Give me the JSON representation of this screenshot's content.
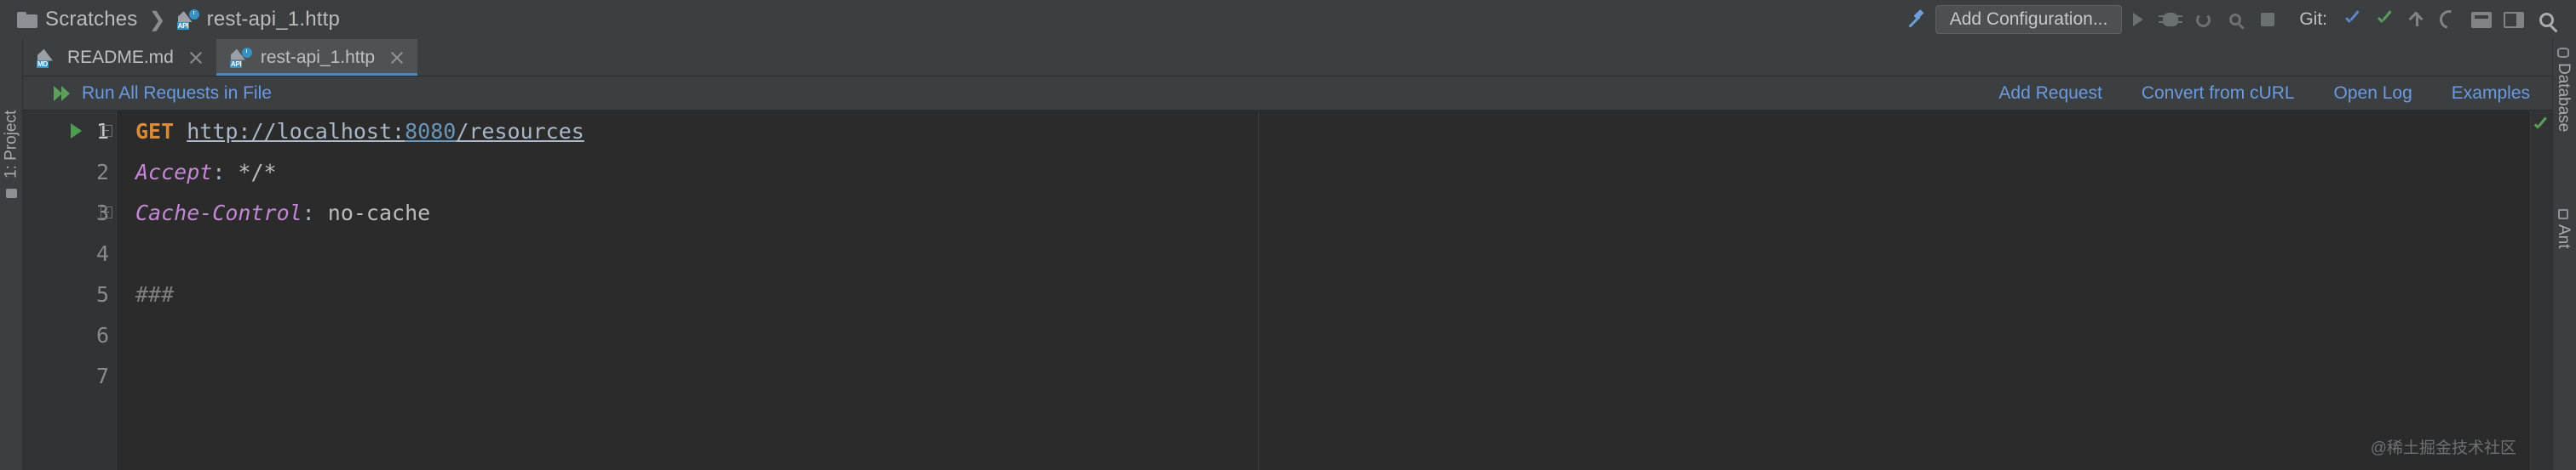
{
  "window": {
    "breadcrumb": [
      {
        "icon": "folder-icon",
        "label": "Scratches"
      },
      {
        "icon": "http-file-icon",
        "label": "rest-api_1.http"
      }
    ],
    "separator": "❯"
  },
  "toolbar": {
    "build_icon": "hammer-icon",
    "run_configuration": "Add Configuration...",
    "actions": [
      {
        "name": "run-button",
        "icon": "run-triangle-icon"
      },
      {
        "name": "debug-button",
        "icon": "bug-icon"
      },
      {
        "name": "rerun-button",
        "icon": "rerun-icon"
      },
      {
        "name": "profile-button",
        "icon": "magnifier-icon"
      },
      {
        "name": "stop-button",
        "icon": "stop-square-icon"
      }
    ],
    "git_label": "Git:",
    "git_actions": [
      {
        "name": "git-update-button",
        "icon": "check-blue-icon"
      },
      {
        "name": "git-commit-button",
        "icon": "check-green-icon"
      },
      {
        "name": "git-push-button",
        "icon": "arrow-up-icon"
      },
      {
        "name": "git-rollback-button",
        "icon": "undo-icon"
      }
    ],
    "right_actions": [
      {
        "name": "tray-button",
        "icon": "tray-icon"
      },
      {
        "name": "layout-button",
        "icon": "layout-icon"
      },
      {
        "name": "search-everywhere-button",
        "icon": "search-icon"
      }
    ]
  },
  "left_strip": {
    "project_label": "1: Project"
  },
  "right_strip": {
    "database_label": "Database",
    "ant_label": "Ant"
  },
  "tabs": [
    {
      "label": "README.md",
      "icon": "md-file-icon",
      "active": false
    },
    {
      "label": "rest-api_1.http",
      "icon": "http-file-icon",
      "active": true
    }
  ],
  "http_toolbar": {
    "run_all_label": "Run All Requests in File",
    "run_all_icon": "double-play-icon",
    "links": [
      {
        "label": "Add Request"
      },
      {
        "label": "Convert from cURL"
      },
      {
        "label": "Open Log"
      },
      {
        "label": "Examples"
      }
    ]
  },
  "editor": {
    "line_count": 7,
    "lines": [
      {
        "number": "1",
        "has_run_gutter": true,
        "fold": "top",
        "tokens": [
          {
            "t": "GET",
            "c": "k-method"
          },
          {
            "t": " ",
            "c": "k-punct"
          },
          {
            "t": "http://localhost:",
            "c": "k-url"
          },
          {
            "t": "8080",
            "c": "k-port"
          },
          {
            "t": "/resources",
            "c": "k-url"
          }
        ]
      },
      {
        "number": "2",
        "has_run_gutter": false,
        "fold": "none",
        "tokens": [
          {
            "t": "Accept",
            "c": "k-header"
          },
          {
            "t": ": ",
            "c": "k-punct"
          },
          {
            "t": "*/*",
            "c": "k-value"
          }
        ]
      },
      {
        "number": "3",
        "has_run_gutter": false,
        "fold": "bottom",
        "tokens": [
          {
            "t": "Cache-Control",
            "c": "k-header"
          },
          {
            "t": ": ",
            "c": "k-punct"
          },
          {
            "t": "no-cache",
            "c": "k-value"
          }
        ]
      },
      {
        "number": "4",
        "has_run_gutter": false,
        "fold": "none",
        "tokens": []
      },
      {
        "number": "5",
        "has_run_gutter": false,
        "fold": "none",
        "tokens": [
          {
            "t": "###",
            "c": "k-sep"
          }
        ]
      },
      {
        "number": "6",
        "has_run_gutter": false,
        "fold": "none",
        "tokens": []
      },
      {
        "number": "7",
        "has_run_gutter": false,
        "fold": "none",
        "tokens": []
      }
    ],
    "inspection_status": "ok-check-icon"
  },
  "watermark": "@稀土掘金技术社区",
  "colors": {
    "background": "#3c3f41",
    "editor_background": "#2b2b2b",
    "gutter_background": "#313335",
    "link_blue": "#6b9ade",
    "tab_active": "#4e5254",
    "tab_underline": "#4a88c7",
    "method_orange": "#d98b3a",
    "header_purple": "#c387d6",
    "number_blue": "#6897bb",
    "run_green": "#5ca05c"
  }
}
